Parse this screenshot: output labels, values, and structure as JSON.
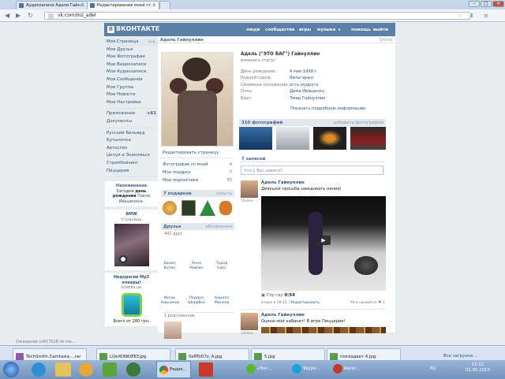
{
  "browser": {
    "tabs": [
      {
        "label": "Аудиозаписи Аделя Гайн…",
        "active": false
      },
      {
        "label": "Редактирование моей ст…",
        "active": true
      }
    ],
    "url": "vk.com/mz_adel",
    "status_text": "Ожидание cs617028.vk.me..."
  },
  "vk": {
    "logo_text": "ВКОНТАКТЕ",
    "logo_letter": "В",
    "top_nav": [
      "люди",
      "сообщества",
      "игры",
      "музыка",
      "помощь",
      "выйти"
    ],
    "left_menu": [
      {
        "label": "Моя Страница",
        "extra": "ред."
      },
      {
        "label": "Мои Друзья"
      },
      {
        "label": "Мои Фотографии"
      },
      {
        "label": "Мои Видеозаписи"
      },
      {
        "label": "Мои Аудиозаписи"
      },
      {
        "label": "Мои Сообщения"
      },
      {
        "label": "Мои Группы"
      },
      {
        "label": "Мои Новости"
      },
      {
        "label": "Мои Настройки"
      }
    ],
    "apps_menu": [
      {
        "label": "Приложения",
        "count": "+61"
      },
      {
        "label": "Документы"
      }
    ],
    "games_menu": [
      "Русский Бильярд",
      "Бутылочка",
      "Автослон",
      "Целуй и Знакомься",
      "Стрипбойзинг",
      "Пиццерия"
    ],
    "reminder": {
      "title": "Напоминание",
      "text_pre": "Сегодня ",
      "text_bold": "день рождения",
      "text_post": " Павла Ивашенина."
    },
    "ad1": {
      "title": "BMW",
      "subtitle": "Страница"
    },
    "ad2": {
      "title": "Недорогие Mp3 плееры!",
      "subtitle": "icoolka.ua",
      "price": "Всего от 280 грн."
    },
    "profile": {
      "name": "Адель Гайнуллин",
      "status_right": "Online",
      "full_name": "Адель (\"ЭТО БАГ\") Гайнуллин",
      "change_status": "изменить статус",
      "info": [
        {
          "label": "День рождения:",
          "value": "4 мая 1998 г."
        },
        {
          "label": "Родной город:",
          "value": "Вильгарын"
        },
        {
          "label": "Семейное положение:",
          "value": "есть подруга"
        },
        {
          "label": "Отец:",
          "value": "Дима Ивашенко"
        },
        {
          "label": "Брат:",
          "value": "Эмир Гайнуллин"
        }
      ],
      "show_more": "Показать подробную информацию",
      "edit_page": "Редактировать страницу",
      "stats": [
        {
          "label": "Фотографии со мной",
          "value": "4"
        },
        {
          "label": "Мои подарки",
          "value": "7"
        },
        {
          "label": "Мои подписчики",
          "value": "55"
        }
      ]
    },
    "gifts": {
      "title": "7 подарков",
      "action": "скрыть"
    },
    "friends": {
      "title": "Друзья",
      "action": "обновления",
      "count": "441 друг",
      "names": [
        {
          "first": "Данил",
          "last": "Котин"
        },
        {
          "first": "Анна",
          "last": "Рейпин"
        },
        {
          "first": "Тород",
          "last": "Сакс"
        },
        {
          "first": "Ихсан",
          "last": "Кирсанов"
        },
        {
          "first": "Раддел",
          "last": "Шерабко"
        },
        {
          "first": "Кирилл",
          "last": "Минеев"
        }
      ]
    },
    "relatives": "1 родственник",
    "photos": {
      "title": "310 фотографий",
      "action": "добавить фотографии"
    },
    "wall": {
      "count": "7 записей",
      "input_placeholder": "Что у Вас нового?",
      "post1": {
        "author": "Адель Гайнуллин",
        "text": "Девушки просьба заведовать нилия)",
        "online": "Online",
        "video_title": "Гоу гоу",
        "video_time": "0:54",
        "meta_time": "вчера в 19:15",
        "meta_edit": "Редактировать",
        "likes": "Мне нравится",
        "like_count": "1"
      },
      "post2": {
        "author": "Адель Гайнуллин",
        "text": "Оцени мой кабинет! В игре Пиццерия!",
        "online": "Online"
      }
    }
  },
  "taskbar": {
    "items": [
      "TechSmith.Camtasia....rar",
      "LQeXONKiEKY.jpg",
      "0eRTo07o_A.jpg",
      "5.jpg",
      "покхадает 4.jpg",
      "Редак...",
      "uTorr...",
      "Skype...",
      "Recor..."
    ],
    "downloads": "Все загрузки...",
    "lang": "RU",
    "time": "11:12",
    "date": "02.05.2013"
  },
  "colors": {
    "vk_blue": "#5b7fa6",
    "link": "#2b587a",
    "header_bg": "#e1e7ed"
  }
}
